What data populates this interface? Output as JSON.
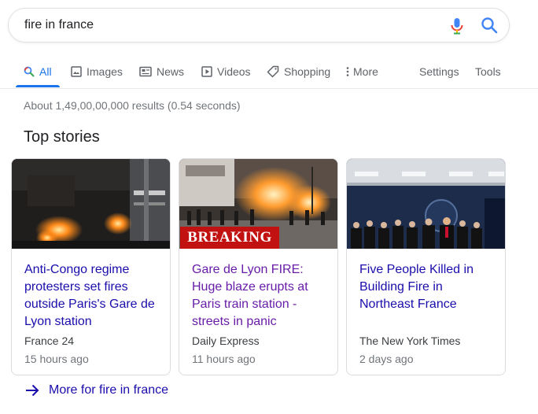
{
  "search": {
    "query": "fire in france"
  },
  "icons": {
    "mic": "mic-icon",
    "search": "search-icon"
  },
  "colors": {
    "accent": "#1a73e8",
    "link": "#1a0dab",
    "visited": "#681da8",
    "breaking": "#c11111"
  },
  "tabs": [
    {
      "label": "All",
      "icon": "search-icon",
      "active": true
    },
    {
      "label": "Images",
      "icon": "image-icon"
    },
    {
      "label": "News",
      "icon": "news-icon"
    },
    {
      "label": "Videos",
      "icon": "video-icon"
    },
    {
      "label": "Shopping",
      "icon": "tag-icon"
    },
    {
      "label": "More",
      "icon": "more-vert-icon"
    }
  ],
  "tools": {
    "settings": "Settings",
    "tools": "Tools"
  },
  "stats": "About 1,49,00,00,000 results (0.54 seconds)",
  "top_stories_title": "Top stories",
  "stories": [
    {
      "headline": "Anti-Congo regime protesters set fires outside Paris's Gare de Lyon station",
      "source": "France 24",
      "time": "15 hours ago"
    },
    {
      "headline": "Gare de Lyon FIRE: Huge blaze erupts at Paris train station - streets in panic",
      "source": "Daily Express",
      "time": "11 hours ago",
      "badge": "BREAKING",
      "visited": true
    },
    {
      "headline": "Five People Killed in Building Fire in Northeast France",
      "source": "The New York Times",
      "time": "2 days ago"
    }
  ],
  "more_link": "More for fire in france"
}
